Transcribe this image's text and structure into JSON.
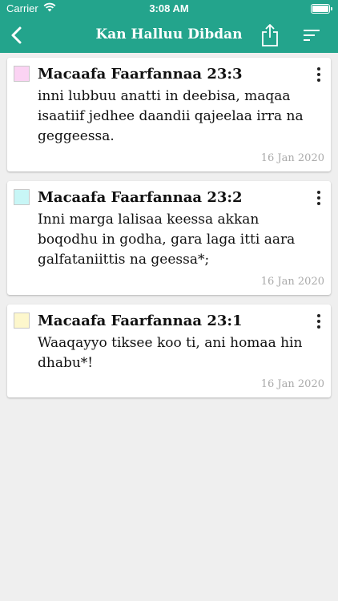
{
  "status": {
    "carrier": "Carrier",
    "time": "3:08 AM"
  },
  "header": {
    "title": "Kan Halluu Dibdan"
  },
  "colors": {
    "bar": "#23a48c"
  },
  "notes": [
    {
      "ref": "Macaafa Faarfannaa 23:3",
      "text": "inni lubbuu anatti in deebisa, maqaa isaatiif jedhee daandii qajeelaa irra na geggeessa.",
      "date": "16 Jan 2020",
      "color": "#fbd3f3"
    },
    {
      "ref": "Macaafa Faarfannaa 23:2",
      "text": "Inni marga lalisaa keessa akkan boqodhu in godha, gara laga itti aara galfataniittis na geessa*;",
      "date": "16 Jan 2020",
      "color": "#c8f6f6"
    },
    {
      "ref": "Macaafa Faarfannaa 23:1",
      "text": "Waaqayyo tiksee koo ti, ani homaa hin dhabu*!",
      "date": "16 Jan 2020",
      "color": "#fdf7cc"
    }
  ]
}
